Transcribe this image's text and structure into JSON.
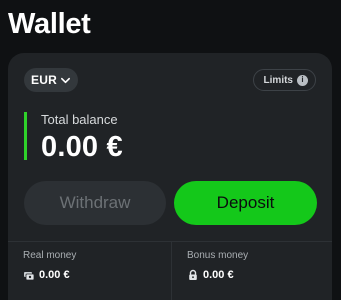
{
  "page": {
    "title": "Wallet"
  },
  "wallet": {
    "currency": "EUR",
    "limits_label": "Limits",
    "info_glyph": "i",
    "total_balance_label": "Total balance",
    "total_balance_value": "0.00 €",
    "withdraw_label": "Withdraw",
    "deposit_label": "Deposit",
    "real_money_label": "Real money",
    "real_money_value": "0.00 €",
    "bonus_money_label": "Bonus money",
    "bonus_money_value": "0.00 €"
  },
  "icons": {
    "currency_dropdown": "chevron-down-icon",
    "limits": "info-icon",
    "real_money": "cash-icon",
    "bonus_money": "lock-icon"
  },
  "colors": {
    "accent_green": "#14c81a",
    "balance_bar_green": "#2fd22a",
    "card_background": "#202326",
    "page_background": "#0f1113",
    "withdraw_disabled": "#2c3034"
  }
}
